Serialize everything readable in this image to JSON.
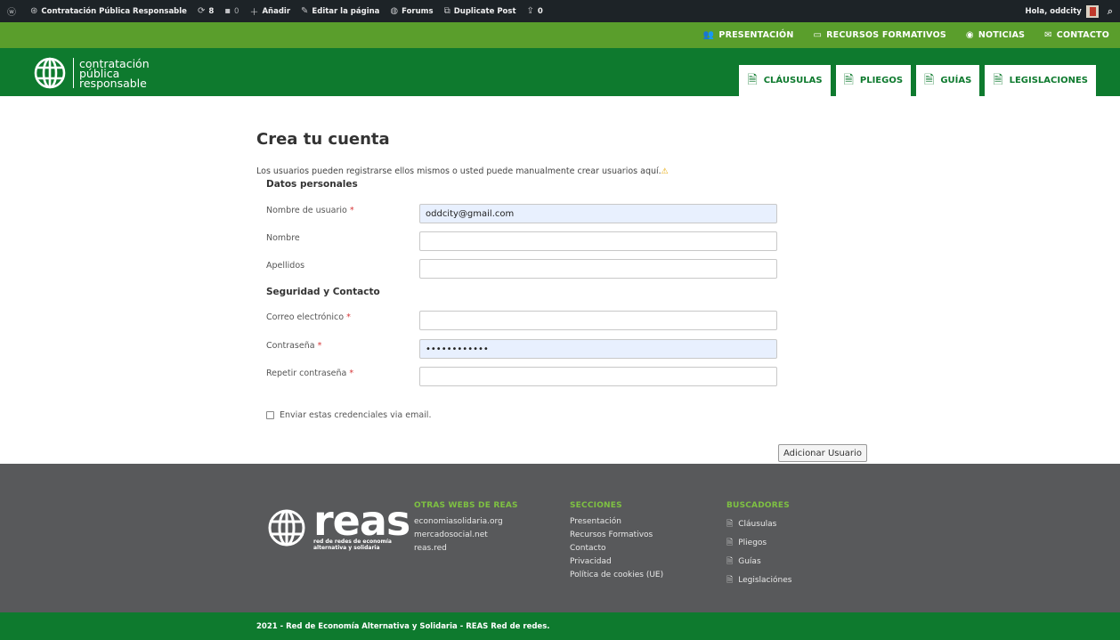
{
  "adminbar": {
    "site_name": "Contratación Pública Responsable",
    "updates_count": "8",
    "comments_count": "0",
    "new_label": "Añadir",
    "edit_label": "Editar la página",
    "forums_label": "Forums",
    "duplicate_label": "Duplicate Post",
    "extra_count": "0",
    "greeting": "Hola, oddcity"
  },
  "topnav": {
    "items": [
      "PRESENTACIÓN",
      "RECURSOS FORMATIVOS",
      "NOTICIAS",
      "CONTACTO"
    ]
  },
  "header": {
    "logo_line1": "contratación",
    "logo_line2": "pública",
    "logo_line3": "responsable",
    "tabs": [
      "CLÁUSULAS",
      "PLIEGOS",
      "GUÍAS",
      "LEGISLACIONES"
    ]
  },
  "form": {
    "title": "Crea tu cuenta",
    "intro": "Los usuarios pueden registrarse ellos mismos o usted puede manualmente crear usuarios aquí.",
    "section_personal": "Datos personales",
    "section_security": "Seguridad y Contacto",
    "required_mark": "*",
    "fields": {
      "username": {
        "label": "Nombre de usuario",
        "value": "oddcity@gmail.com"
      },
      "firstname": {
        "label": "Nombre",
        "value": ""
      },
      "lastname": {
        "label": "Apellidos",
        "value": ""
      },
      "email": {
        "label": "Correo electrónico",
        "value": ""
      },
      "password": {
        "label": "Contraseña",
        "value": "••••••••••••"
      },
      "password_repeat": {
        "label": "Repetir contraseña",
        "value": ""
      }
    },
    "send_credentials_label": "Enviar estas credenciales via email.",
    "submit_label": "Adicionar Usuario"
  },
  "footer": {
    "reas_logo_text": "reas",
    "reas_logo_sub1": "red de redes de economía",
    "reas_logo_sub2": "alternativa y solidaria",
    "col_webs_title": "OTRAS WEBS DE REAS",
    "col_webs_links": [
      "economiasolidaria.org",
      "mercadosocial.net",
      "reas.red"
    ],
    "col_sections_title": "SECCIONES",
    "col_sections_links": [
      "Presentación",
      "Recursos Formativos",
      "Contacto",
      "Privacidad",
      "Política de cookies (UE)"
    ],
    "col_search_title": "BUSCADORES",
    "col_search_links": [
      "Cláusulas",
      "Pliegos",
      "Guías",
      "Legislaciónes"
    ],
    "copyright": "2021 - Red de Economía Alternativa y Solidaria - REAS Red de redes."
  },
  "colors": {
    "admin_bar": "#1d2327",
    "top_nav": "#5a9e2c",
    "header": "#0e7a2e",
    "footer": "#58595b",
    "footer_heading": "#7ec142"
  }
}
